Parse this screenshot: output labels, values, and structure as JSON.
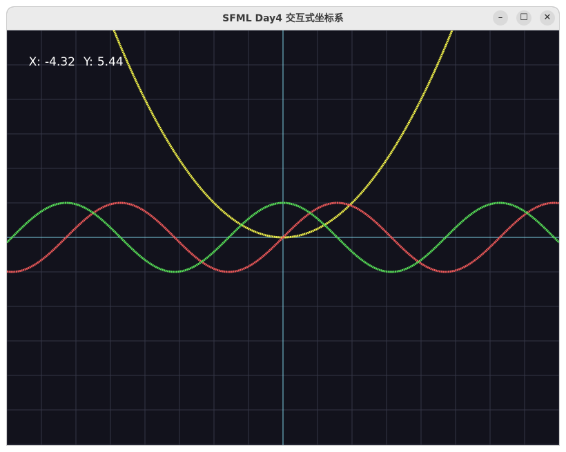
{
  "window": {
    "title": "SFML Day4 交互式坐标系",
    "controls": {
      "minimize_glyph": "–",
      "maximize_glyph": "☐",
      "close_glyph": "✕"
    }
  },
  "readout": {
    "x_label": "X:",
    "x_value": "-4.32",
    "y_label": "Y:",
    "y_value": "5.44"
  },
  "colors": {
    "background": "#12121c",
    "grid": "#343646",
    "axes": "#7fd3e6",
    "parabola": "#f2f24a",
    "sine": "#f05a5a",
    "cosine": "#58e058"
  },
  "chart_data": {
    "type": "line",
    "grid": true,
    "xlim": [
      -8,
      8
    ],
    "ylim": [
      -6,
      6
    ],
    "series": [
      {
        "expr": "y = 0.25x²",
        "color": "#f2f24a",
        "domain": [
          -5,
          5
        ]
      },
      {
        "expr": "y = sin(x)",
        "color": "#f05a5a",
        "domain": [
          -8,
          8
        ]
      },
      {
        "expr": "y = cos(x)",
        "color": "#58e058",
        "domain": [
          -8,
          8
        ]
      }
    ]
  }
}
